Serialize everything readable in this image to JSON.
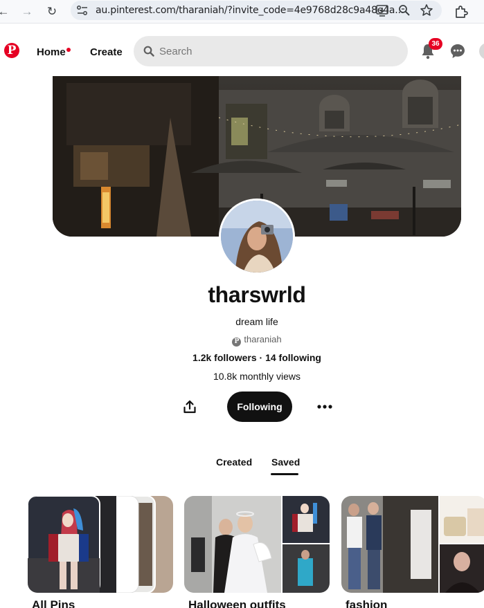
{
  "browser": {
    "url": "au.pinterest.com/tharaniah/?invite_code=4e9768d28c9a48e4a..."
  },
  "header": {
    "home_label": "Home",
    "create_label": "Create",
    "search_placeholder": "Search",
    "notification_count": "36",
    "icons": [
      "pinterest-logo-icon",
      "search-icon",
      "bell-icon",
      "chat-icon"
    ]
  },
  "profile": {
    "display_name": "tharswrld",
    "bio": "dream life",
    "username": "tharaniah",
    "followers": "1.2k followers",
    "separator": " · ",
    "following": "14 following",
    "monthly_views": "10.8k monthly views",
    "follow_button_label": "Following"
  },
  "tabs": [
    {
      "label": "Created",
      "active": false
    },
    {
      "label": "Saved",
      "active": true
    }
  ],
  "boards": [
    {
      "title": "All Pins"
    },
    {
      "title": "Halloween outfits"
    },
    {
      "title": "fashion"
    }
  ],
  "colors": {
    "brand": "#e60023",
    "button_dark": "#111111",
    "search_bg": "#e9e9e9"
  }
}
